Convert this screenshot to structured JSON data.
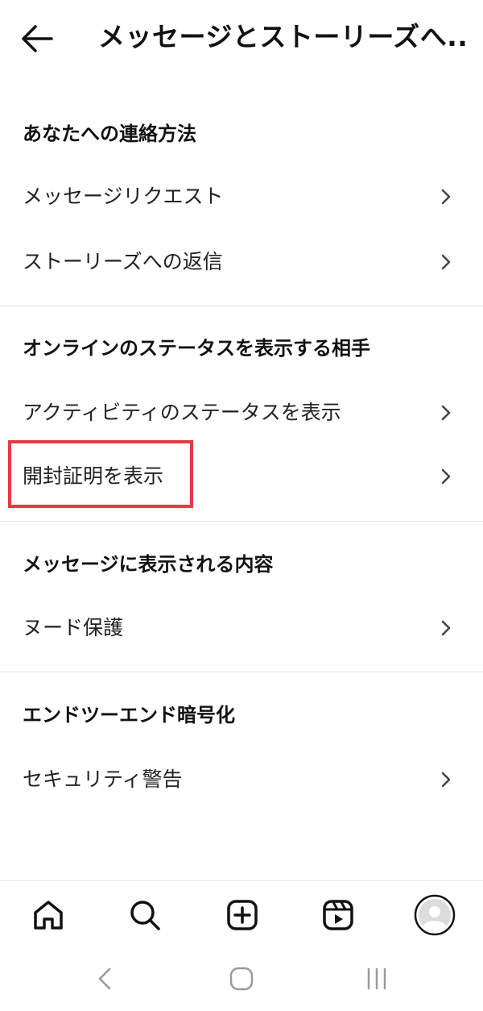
{
  "header": {
    "title": "メッセージとストーリーズへ..."
  },
  "sections": [
    {
      "title": "あなたへの連絡方法",
      "items": [
        {
          "label": "メッセージリクエスト"
        },
        {
          "label": "ストーリーズへの返信"
        }
      ]
    },
    {
      "title": "オンラインのステータスを表示する相手",
      "items": [
        {
          "label": "アクティビティのステータスを表示"
        },
        {
          "label": "開封証明を表示"
        }
      ]
    },
    {
      "title": "メッセージに表示される内容",
      "items": [
        {
          "label": "ヌード保護"
        }
      ]
    },
    {
      "title": "エンドツーエンド暗号化",
      "items": [
        {
          "label": "セキュリティ警告"
        }
      ]
    }
  ],
  "bottom_nav": [
    "home-icon",
    "search-icon",
    "create-icon",
    "reels-icon",
    "profile-avatar"
  ],
  "highlight_color": "#e53a3f"
}
